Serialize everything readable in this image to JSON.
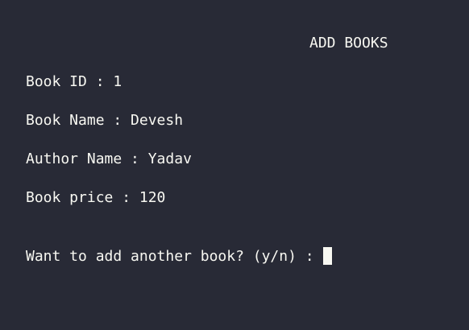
{
  "terminal": {
    "background_color": "#282a36",
    "text_color": "#f8f8f2",
    "cursor_color": "#f8f8f2",
    "title": "ADD BOOKS",
    "lines": [
      "Book ID : 1",
      "Book Name : Devesh",
      "Author Name : Yadav",
      "Book price : 120"
    ],
    "prompt": "Want to add another book? (y/n) : "
  }
}
